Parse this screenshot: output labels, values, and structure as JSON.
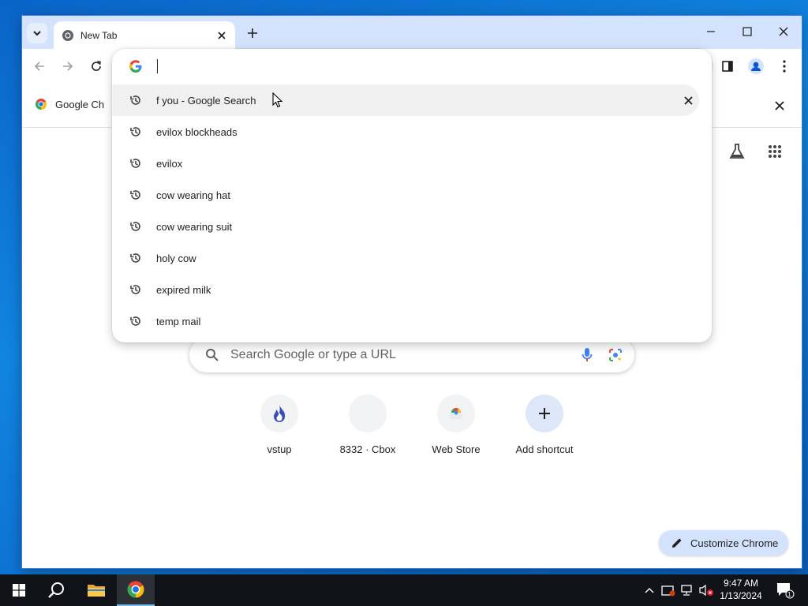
{
  "browser": {
    "tab": {
      "title": "New Tab"
    },
    "bookmark": {
      "label": "Google Ch"
    }
  },
  "omnibox": {
    "value": "",
    "suggestions": [
      {
        "text": "f you - Google Search",
        "selected": true
      },
      {
        "text": "evilox blockheads"
      },
      {
        "text": "evilox"
      },
      {
        "text": "cow wearing hat"
      },
      {
        "text": "cow wearing suit"
      },
      {
        "text": "holy cow"
      },
      {
        "text": "expired milk"
      },
      {
        "text": "temp mail"
      }
    ]
  },
  "ntp": {
    "search_placeholder": "Search Google or type a URL",
    "shortcuts": [
      {
        "label": "vstup",
        "icon": "flame-icon"
      },
      {
        "label": "8332 · Cbox",
        "icon": "blank-icon"
      },
      {
        "label": "Web Store",
        "icon": "webstore-icon"
      },
      {
        "label": "Add shortcut",
        "icon": "plus-icon"
      }
    ],
    "customize_label": "Customize Chrome"
  },
  "taskbar": {
    "time": "9:47 AM",
    "date": "1/13/2024",
    "notification_count": "1"
  },
  "colors": {
    "tabstrip": "#d3e3fd",
    "accent": "#1a73e8",
    "desktop": "#0a64c8"
  }
}
